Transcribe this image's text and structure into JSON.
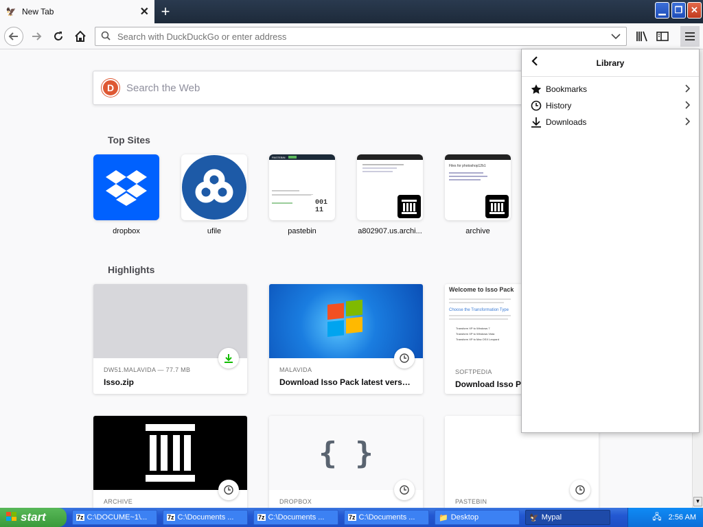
{
  "tab": {
    "title": "New Tab",
    "favicon": "mypal-icon"
  },
  "window": {
    "minimize": "▁",
    "maximize": "❐",
    "close": "✕"
  },
  "navbar": {
    "url_placeholder": "Search with DuckDuckGo or enter address"
  },
  "search": {
    "placeholder": "Search the Web"
  },
  "top_sites": {
    "title": "Top Sites",
    "items": [
      {
        "label": "dropbox"
      },
      {
        "label": "ufile"
      },
      {
        "label": "pastebin"
      },
      {
        "label": "a802907.us.archi..."
      },
      {
        "label": "archive"
      }
    ]
  },
  "highlights": {
    "title": "Highlights",
    "cards": [
      {
        "source": "DW51.MALAVIDA — 77.7 MB",
        "title": "Isso.zip"
      },
      {
        "source": "MALAVIDA",
        "title": "Download Isso Pack latest versio..."
      },
      {
        "source": "SOFTPEDIA",
        "title": "Download Isso Pa"
      },
      {
        "source": "ARCHIVE",
        "title": ""
      },
      {
        "source": "DROPBOX",
        "title": ""
      },
      {
        "source": "PASTEBIN",
        "title": ""
      }
    ],
    "preview_texts": {
      "softpedia_heading": "Welcome to Isso Pack",
      "softpedia_sub": "Choose the Transformation Type",
      "softpedia_opt1": "Transform XP to Windows 7",
      "softpedia_opt2": "Transform XP to Windows Vista",
      "softpedia_opt3": "Transform XP to Mac OSX Leopard",
      "archive_files": "Files for photoshop12b1",
      "pastebin_brand": "PASTEBIN",
      "dropbox_braces": "{ }",
      "binary_icon": "001\n11"
    }
  },
  "library_panel": {
    "title": "Library",
    "items": [
      {
        "label": "Bookmarks",
        "icon": "star-icon"
      },
      {
        "label": "History",
        "icon": "clock-icon"
      },
      {
        "label": "Downloads",
        "icon": "download-icon"
      }
    ]
  },
  "taskbar": {
    "start": "start",
    "tasks": [
      {
        "label": "C:\\DOCUME~1\\..."
      },
      {
        "label": "C:\\Documents ..."
      },
      {
        "label": "C:\\Documents ..."
      },
      {
        "label": "C:\\Documents ..."
      },
      {
        "label": "Desktop"
      },
      {
        "label": "Mypal"
      }
    ],
    "clock": "2:56 AM"
  },
  "colors": {
    "dropbox_blue": "#0061fe",
    "ufile_blue": "#1d5aa7",
    "ddg_orange": "#de5833",
    "download_green": "#12bc00"
  }
}
